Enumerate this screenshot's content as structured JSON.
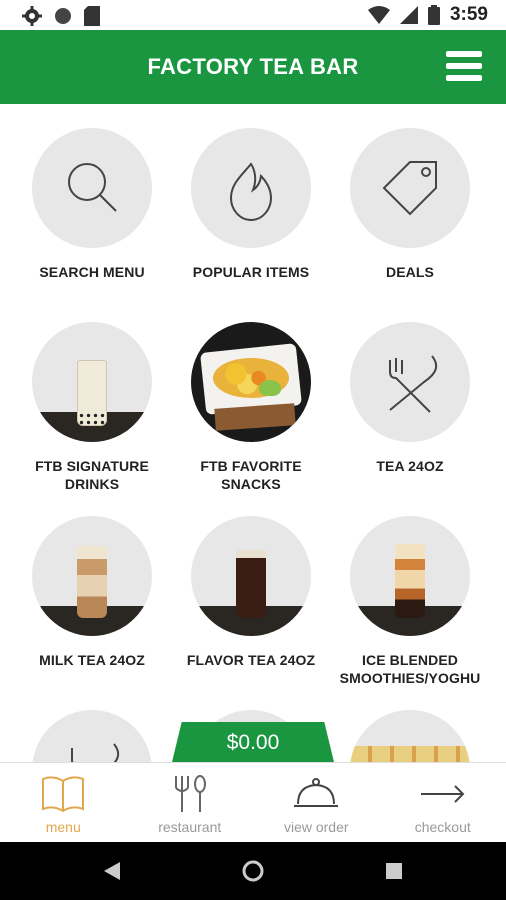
{
  "status_bar": {
    "time": "3:59",
    "icons_left": [
      "settings-icon",
      "circle-icon",
      "sd-card-icon"
    ],
    "icons_right": [
      "wifi-icon",
      "signal-icon",
      "battery-icon"
    ]
  },
  "app_bar": {
    "title": "FACTORY TEA BAR",
    "menu_icon": "hamburger-icon",
    "color": "#1a9641"
  },
  "tiles": [
    {
      "label": "SEARCH MENU",
      "icon": "search-icon"
    },
    {
      "label": "POPULAR ITEMS",
      "icon": "flame-icon"
    },
    {
      "label": "DEALS",
      "icon": "price-tag-icon"
    },
    {
      "label_line1": "FTB SIGNATURE",
      "label_line2": "DRINKS"
    },
    {
      "label_line1": "FTB FAVORITE",
      "label_line2": "SNACKS"
    },
    {
      "label": "TEA 24OZ",
      "icon": "fork-knife-icon"
    },
    {
      "label": "MILK TEA 24OZ"
    },
    {
      "label": "FLAVOR TEA 24OZ"
    },
    {
      "label_line1": "ICE BLENDED",
      "label_line2": "SMOOTHIES/YOGHU"
    }
  ],
  "cart": {
    "total": "$0.00"
  },
  "bottom_nav": [
    {
      "label": "menu",
      "icon": "book-icon",
      "active": true
    },
    {
      "label": "restaurant",
      "icon": "fork-spoon-icon",
      "active": false
    },
    {
      "label": "view order",
      "icon": "cloche-icon",
      "active": false
    },
    {
      "label": "checkout",
      "icon": "arrow-right-icon",
      "active": false
    }
  ],
  "accent_active": "#e0a84a"
}
